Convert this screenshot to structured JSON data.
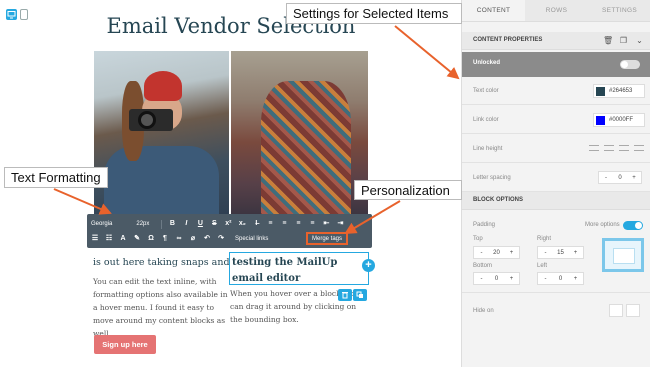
{
  "editor": {
    "email_title": "Email Vendor Selection",
    "left_heading": "is out here taking snaps and",
    "left_body": "You can edit the text inline, with formatting options also available in a hover menu. I found it easy to move around my content blocks as well.",
    "right_heading": "testing the MailUp email editor",
    "right_body": "When you hover over a block, you can drag it around by clicking on the bounding box.",
    "signup_label": "Sign up here"
  },
  "toolbar": {
    "font_family": "Georgia",
    "font_size": "22px",
    "special_links": "Special links",
    "merge_tags": "Merge tags"
  },
  "callouts": {
    "settings": "Settings for Selected Items",
    "text_formatting": "Text Formatting",
    "personalization": "Personalization"
  },
  "panel": {
    "tabs": [
      "CONTENT",
      "ROWS",
      "SETTINGS"
    ],
    "content_properties": "CONTENT PROPERTIES",
    "unlocked": "Unlocked",
    "text_color_label": "Text color",
    "text_color_value": "#264653",
    "link_color_label": "Link color",
    "link_color_value": "#0000FF",
    "line_height_label": "Line height",
    "letter_spacing_label": "Letter spacing",
    "letter_spacing_value": "0",
    "block_options": "BLOCK OPTIONS",
    "padding_label": "Padding",
    "more_options": "More options",
    "top_label": "Top",
    "top_value": "20",
    "right_label": "Right",
    "right_value": "15",
    "bottom_label": "Bottom",
    "bottom_value": "0",
    "left_label": "Left",
    "left_value": "0",
    "hide_on": "Hide on",
    "minus": "-",
    "plus": "+"
  },
  "colors": {
    "accent": "#25a8e0",
    "title": "#264653",
    "callout_arrow": "#e8622c",
    "signup_button": "#e57373"
  }
}
